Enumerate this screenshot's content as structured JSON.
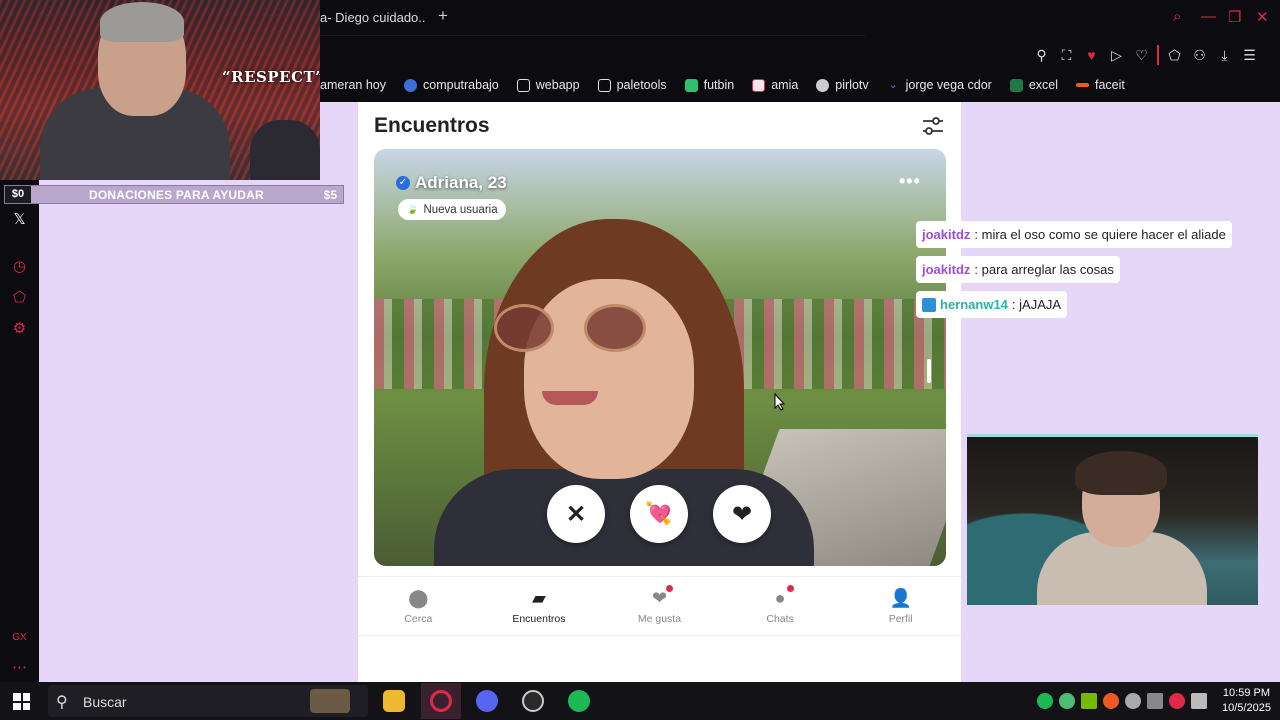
{
  "browser": {
    "tab_title": "a- Diego cuidado..",
    "new_tab": "+",
    "bookmarks": [
      {
        "label": "ameran hoy",
        "icon": "none"
      },
      {
        "label": "computrabajo",
        "icon": "computrabajo-icon"
      },
      {
        "label": "webapp",
        "icon": "page-icon"
      },
      {
        "label": "paletools",
        "icon": "page-icon"
      },
      {
        "label": "futbin",
        "icon": "futbin-icon"
      },
      {
        "label": "amia",
        "icon": "amia-icon"
      },
      {
        "label": "pirlotv",
        "icon": "pirlotv-icon"
      },
      {
        "label": "jorge vega cdor",
        "icon": "chevron-icon"
      },
      {
        "label": "excel",
        "icon": "excel-icon"
      },
      {
        "label": "faceit",
        "icon": "faceit-icon"
      }
    ],
    "accent": "#e0284a"
  },
  "stream_overlay": {
    "webcam_caption": "“RESPECT”",
    "donation": {
      "left_amount": "$0",
      "label": "DONACIONES PARA AYUDAR",
      "goal": "$5"
    },
    "chat": [
      {
        "user": "joakitdz",
        "text": ": mira el oso como se quiere hacer el aliade",
        "color": "#9b4fd6"
      },
      {
        "user": "joakitdz",
        "text": ": para arreglar las cosas",
        "color": "#9b4fd6"
      },
      {
        "user": "hernanw14",
        "text": ": jAJAJA",
        "color": "#2bb3a3"
      }
    ]
  },
  "app": {
    "title": "Encuentros",
    "profile": {
      "name": "Adriana, 23",
      "badge": "Nueva usuaria",
      "verified": true
    },
    "actions": [
      {
        "name": "dislike",
        "glyph": "✕"
      },
      {
        "name": "crush",
        "glyph": "💘"
      },
      {
        "name": "like",
        "glyph": "❤"
      }
    ],
    "nav": [
      {
        "label": "Cerca",
        "icon": "location-pin-icon",
        "active": false,
        "notification": false
      },
      {
        "label": "Encuentros",
        "icon": "cards-icon",
        "active": true,
        "notification": false
      },
      {
        "label": "Me gusta",
        "icon": "heart-bubble-icon",
        "active": false,
        "notification": true
      },
      {
        "label": "Chats",
        "icon": "chat-bubble-icon",
        "active": false,
        "notification": true
      },
      {
        "label": "Perfil",
        "icon": "person-icon",
        "active": false,
        "notification": false
      }
    ]
  },
  "taskbar": {
    "search_placeholder": "Buscar",
    "time": "10:59 PM",
    "date": "10/5/2025"
  }
}
